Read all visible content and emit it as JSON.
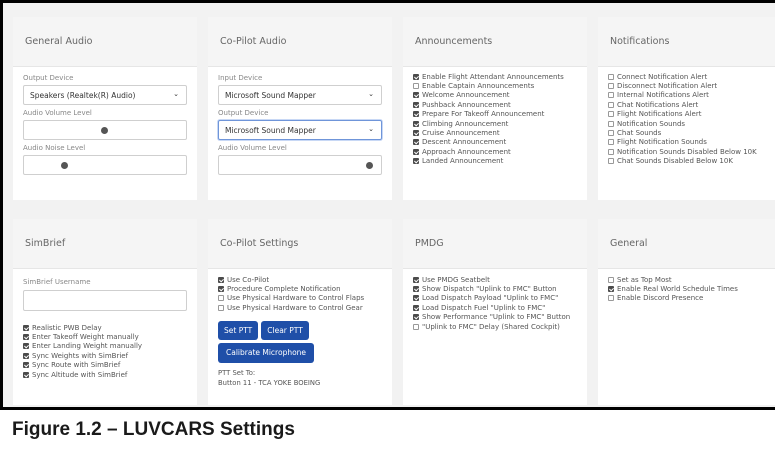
{
  "general_audio": {
    "title": "General Audio",
    "output_device_label": "Output Device",
    "output_device_value": "Speakers (Realtek(R) Audio)",
    "audio_volume_label": "Audio Volume Level",
    "audio_volume_level": 0.5,
    "audio_noise_label": "Audio Noise Level",
    "audio_noise_level": 0.25
  },
  "copilot_audio": {
    "title": "Co-Pilot Audio",
    "input_device_label": "Input Device",
    "input_device_value": "Microsoft Sound Mapper",
    "output_device_label": "Output Device",
    "output_device_value": "Microsoft Sound Mapper",
    "audio_volume_label": "Audio Volume Level",
    "audio_volume_level": 0.93
  },
  "announcements": {
    "title": "Announcements",
    "items": [
      {
        "label": "Enable Flight Attendant Announcements",
        "checked": true
      },
      {
        "label": "Enable Captain Announcements",
        "checked": false
      },
      {
        "label": "Welcome Announcement",
        "checked": true
      },
      {
        "label": "Pushback Announcement",
        "checked": true
      },
      {
        "label": "Prepare For Takeoff Announcement",
        "checked": true
      },
      {
        "label": "Climbing Announcement",
        "checked": true
      },
      {
        "label": "Cruise Announcement",
        "checked": true
      },
      {
        "label": "Descent Announcement",
        "checked": true
      },
      {
        "label": "Approach Announcement",
        "checked": true
      },
      {
        "label": "Landed Announcement",
        "checked": true
      }
    ]
  },
  "notifications": {
    "title": "Notifications",
    "items": [
      {
        "label": "Connect Notification Alert",
        "checked": false
      },
      {
        "label": "Disconnect Notification Alert",
        "checked": false
      },
      {
        "label": "Internal Notifications Alert",
        "checked": false
      },
      {
        "label": "Chat Notifications Alert",
        "checked": false
      },
      {
        "label": "Flight Notifications Alert",
        "checked": false
      },
      {
        "label": "Notification Sounds",
        "checked": false
      },
      {
        "label": "Chat Sounds",
        "checked": false
      },
      {
        "label": "Flight Notification Sounds",
        "checked": false
      },
      {
        "label": "Notification Sounds Disabled Below 10K",
        "checked": false
      },
      {
        "label": "Chat Sounds Disabled Below 10K",
        "checked": false
      }
    ]
  },
  "simbrief": {
    "title": "SimBrief",
    "username_label": "SimBrief Username",
    "username_value": "",
    "items": [
      {
        "label": "Realistic PWB Delay",
        "checked": true
      },
      {
        "label": "Enter Takeoff Weight manually",
        "checked": true
      },
      {
        "label": "Enter Landing Weight manually",
        "checked": true
      },
      {
        "label": "Sync Weights with SimBrief",
        "checked": true
      },
      {
        "label": "Sync Route with SimBrief",
        "checked": true
      },
      {
        "label": "Sync Altitude with SimBrief",
        "checked": true
      }
    ]
  },
  "copilot_settings": {
    "title": "Co-Pilot Settings",
    "items": [
      {
        "label": "Use Co-Pilot",
        "checked": true
      },
      {
        "label": "Procedure Complete Notification",
        "checked": true
      },
      {
        "label": "Use Physical Hardware to Control Flaps",
        "checked": false
      },
      {
        "label": "Use Physical Hardware to Control Gear",
        "checked": false
      }
    ],
    "set_ptt_label": "Set PTT",
    "clear_ptt_label": "Clear PTT",
    "calibrate_label": "Calibrate Microphone",
    "ptt_set_to_label": "PTT Set To:",
    "ptt_value": "Button 11 - TCA YOKE BOEING"
  },
  "pmdg": {
    "title": "PMDG",
    "items": [
      {
        "label": "Use PMDG Seatbelt",
        "checked": true
      },
      {
        "label": "Show Dispatch \"Uplink to FMC\" Button",
        "checked": true
      },
      {
        "label": "Load Dispatch Payload \"Uplink to FMC\"",
        "checked": true
      },
      {
        "label": "Load Dispatch Fuel \"Uplink to FMC\"",
        "checked": true
      },
      {
        "label": "Show Performance \"Uplink to FMC\" Button",
        "checked": true
      },
      {
        "label": "\"Uplink to FMC\" Delay (Shared Cockpit)",
        "checked": false
      }
    ]
  },
  "general": {
    "title": "General",
    "items": [
      {
        "label": "Set as Top Most",
        "checked": false
      },
      {
        "label": "Enable Real World Schedule Times",
        "checked": true
      },
      {
        "label": "Enable Discord Presence",
        "checked": false
      }
    ]
  },
  "caption": "Figure 1.2 – LUVCARS Settings",
  "icons": {
    "dropdown": "chevron-down-icon",
    "checkbox": "checkbox-icon"
  }
}
